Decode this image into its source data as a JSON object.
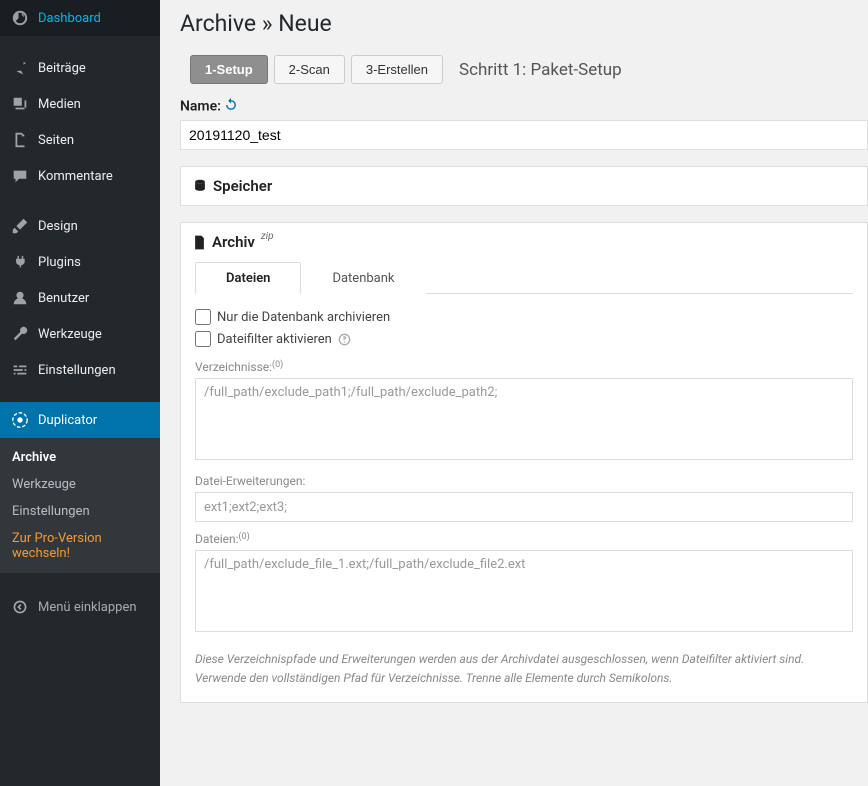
{
  "sidebar": {
    "items": [
      {
        "label": "Dashboard"
      },
      {
        "label": "Beiträge"
      },
      {
        "label": "Medien"
      },
      {
        "label": "Seiten"
      },
      {
        "label": "Kommentare"
      },
      {
        "label": "Design"
      },
      {
        "label": "Plugins"
      },
      {
        "label": "Benutzer"
      },
      {
        "label": "Werkzeuge"
      },
      {
        "label": "Einstellungen"
      },
      {
        "label": "Duplicator"
      }
    ],
    "submenu": [
      {
        "label": "Archive"
      },
      {
        "label": "Werkzeuge"
      },
      {
        "label": "Einstellungen"
      },
      {
        "label": "Zur Pro-Version wechseln!"
      }
    ],
    "collapse_label": "Menü einklappen"
  },
  "page": {
    "title": "Archive » Neue"
  },
  "steps": {
    "s1": "1-Setup",
    "s2": "2-Scan",
    "s3": "3-Erstellen",
    "current_label": "Schritt 1: Paket-Setup"
  },
  "name": {
    "label": "Name:",
    "value": "20191120_test"
  },
  "storage": {
    "title": "Speicher"
  },
  "archive": {
    "title": "Archiv",
    "format": "zip",
    "tabs": {
      "files": "Dateien",
      "db": "Datenbank"
    },
    "checkbox_db_only": "Nur die Datenbank archivieren",
    "checkbox_filter": "Dateifilter aktivieren",
    "dirs_label": "Verzeichnisse:",
    "dirs_count": "(0)",
    "dirs_placeholder": "/full_path/exclude_path1;/full_path/exclude_path2;",
    "exts_label": "Datei-Erweiterungen:",
    "exts_placeholder": "ext1;ext2;ext3;",
    "files_label": "Dateien:",
    "files_count": "(0)",
    "files_placeholder": "/full_path/exclude_file_1.ext;/full_path/exclude_file2.ext",
    "note1": "Diese Verzeichnispfade und Erweiterungen werden aus der Archivdatei ausgeschlossen, wenn Dateifilter aktiviert sind.",
    "note2": "Verwende den vollständigen Pfad für Verzeichnisse. Trenne alle Elemente durch Semikolons."
  }
}
